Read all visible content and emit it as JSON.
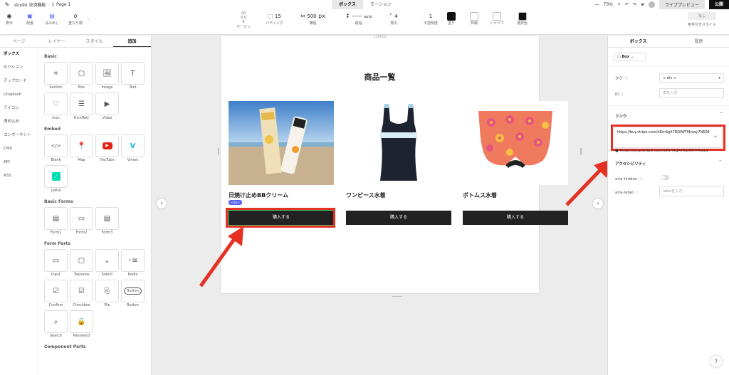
{
  "topbar": {
    "project": "studio 決済機能",
    "page": "Page 1",
    "tabs": [
      "ボックス",
      "モーション"
    ],
    "zoom": "73%",
    "live_preview": "ライブプレビュー",
    "publish": "公開"
  },
  "toolbar": {
    "display": "表示",
    "align": "配置",
    "overflow": "はみ出し",
    "overflow_val": "0",
    "repeat": "重なり順",
    "margin": "マージン",
    "margin_top": "20",
    "margin_lr": "0  0",
    "margin_bottom": "0",
    "padding": "パディング",
    "padding_val": "15",
    "width_label": "横幅",
    "width_val": "500",
    "width_unit": "px",
    "height_label": "縦幅",
    "height_val": "auto",
    "height_dashes": "-----",
    "radius": "角丸",
    "radius_val": "4",
    "opacity": "不透明度",
    "opacity_val": "1",
    "fill": "塗り",
    "border": "枠線",
    "shadow": "シャドウ",
    "selected_color": "選択色",
    "condition_none": "なし",
    "condition_style": "条件付きスタイル"
  },
  "left_panel": {
    "tabs": [
      "ページ",
      "レイヤー",
      "スタイル",
      "追加"
    ],
    "nav": [
      "ボックス",
      "セクション",
      "アップロード",
      "Unsplash",
      "アイコン",
      "埋め込み",
      "コンポーネント",
      "CMS",
      "API",
      "RSS"
    ],
    "sections": [
      {
        "title": "Basic",
        "items": [
          "Section",
          "Box",
          "Image",
          "Text",
          "Icon",
          "RichText",
          "Video"
        ]
      },
      {
        "title": "Embed",
        "items": [
          "Blank",
          "Map",
          "YouTube",
          "Vimeo",
          "Lottie"
        ]
      },
      {
        "title": "Basic Forms",
        "items": [
          "Form1",
          "Form2",
          "Form3"
        ]
      },
      {
        "title": "Form Parts",
        "items": [
          "Input",
          "Textarea",
          "Select",
          "Radio",
          "Confirm",
          "Checkbox",
          "File",
          "Button",
          "Search",
          "Password"
        ]
      },
      {
        "title": "Component Parts",
        "items": []
      }
    ]
  },
  "canvas": {
    "width_label": "1280px",
    "heading": "商品一覧",
    "div_tag": "<div>",
    "products": [
      {
        "name": "日焼け止めBBクリーム",
        "buy": "購入する"
      },
      {
        "name": "ワンピース水着",
        "buy": "購入する"
      },
      {
        "name": "ボトムス水着",
        "buy": "購入する"
      }
    ]
  },
  "right_panel": {
    "tabs": [
      "ボックス",
      "履歴"
    ],
    "box_select": "Box",
    "tag_label": "タグ",
    "tag_value": "< div >",
    "id_label": "ID",
    "id_placeholder": "IDを入力",
    "link_label": "リンク",
    "link_value": "https://buy.stripe.com/dRm4gA7BDfWTf4iaay7N608",
    "link_suggestion": "https://buy.stripe.com/dRm4gA7BDfWTf4iaay",
    "accessibility": "アクセシビリティ",
    "aria_hidden": "aria-hidden",
    "aria_label": "aria-label",
    "aria_label_placeholder": "labelを入力"
  },
  "colors": {
    "highlight": "#e53123",
    "accent": "#5865f2",
    "button": "#222222"
  }
}
